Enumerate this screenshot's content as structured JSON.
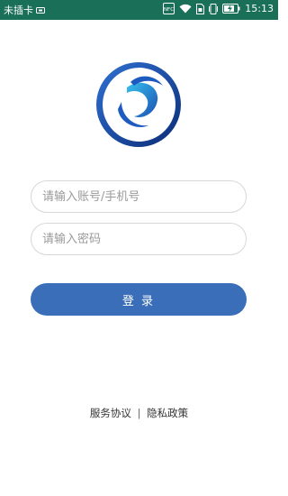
{
  "status_bar": {
    "carrier": "未插卡",
    "nfc": "NFC",
    "time": "15:13",
    "background_color": "#1a6f58",
    "icons": [
      "sim-card-icon",
      "nfc-icon",
      "wifi-icon",
      "sim-card-icon",
      "vibrate-icon",
      "battery-charging-icon"
    ]
  },
  "login": {
    "account_placeholder": "请输入账号/手机号",
    "password_placeholder": "请输入密码",
    "login_label": "登 录",
    "accent_color": "#3a6eb8"
  },
  "footer": {
    "service_agreement": "服务协议",
    "separator": "|",
    "privacy_policy": "隐私政策"
  }
}
